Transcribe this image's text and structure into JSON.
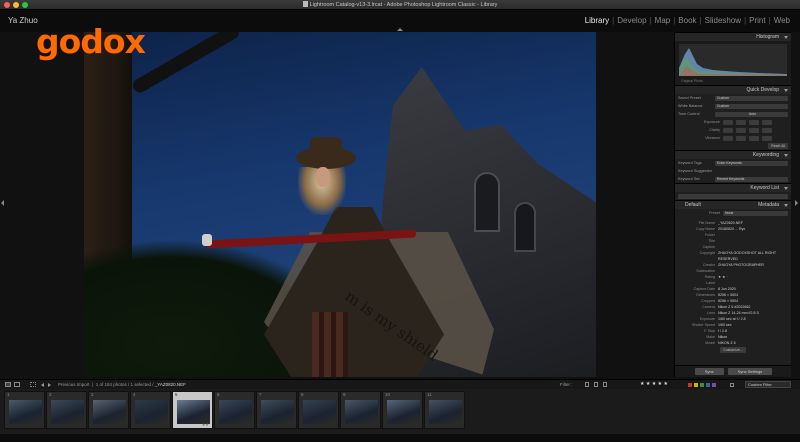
{
  "window": {
    "title": "Lightroom Catalog-v13-3.lrcat - Adobe Photoshop Lightroom Classic - Library"
  },
  "identity_plate": "Ya Zhuo",
  "modules": [
    "Library",
    "Develop",
    "Map",
    "Book",
    "Slideshow",
    "Print",
    "Web"
  ],
  "active_module": "Library",
  "logo_text": "godox",
  "photo": {
    "banner_text": "m is my shield"
  },
  "right_panel": {
    "histogram": {
      "title": "Histogram",
      "info": "Original Photo"
    },
    "quick_develop": {
      "title": "Quick Develop",
      "saved_preset_label": "Saved Preset",
      "saved_preset_value": "Custom",
      "white_balance_label": "White Balance",
      "white_balance_value": "Custom",
      "tone_control_label": "Tone Control",
      "tone_control_value": "Auto",
      "sliders": [
        "Exposure",
        "Clarity",
        "Vibrance"
      ],
      "reset_label": "Reset All"
    },
    "keywording": {
      "title": "Keywording",
      "keyword_tags_label": "Keyword Tags",
      "keyword_tags_value": "Enter Keywords",
      "suggestions_label": "Keyword Suggestions",
      "keyword_set_label": "Keyword Set",
      "keyword_set_value": "Recent Keywords"
    },
    "keyword_list": {
      "title": "Keyword List"
    },
    "metadata": {
      "title": "Metadata",
      "preset_label": "Default",
      "preset2_label": "Preset",
      "preset2_value": "None",
      "fields": [
        {
          "k": "File Name",
          "v": "_YAZ0820.NEF"
        },
        {
          "k": "Copy Name",
          "v": "20180820 ... Ryx"
        },
        {
          "k": "Folder",
          "v": ""
        },
        {
          "k": "Title",
          "v": ""
        },
        {
          "k": "Caption",
          "v": ""
        },
        {
          "k": "Copyright",
          "v": "ZHUOYA GODOXSHOT ALL RIGHT"
        },
        {
          "k": "",
          "v": "RESERVED"
        },
        {
          "k": "Creator",
          "v": "ZHUOYA PHOTOGRAPHER"
        },
        {
          "k": "Sublocation",
          "v": ""
        },
        {
          "k": "Rating",
          "v": "★ ★ ·"
        },
        {
          "k": "Label",
          "v": ""
        },
        {
          "k": "Capture Date",
          "v": "8 Jun 2020"
        },
        {
          "k": "Dimensions",
          "v": "8256 × 5504"
        },
        {
          "k": "Cropped",
          "v": "8256 × 5504"
        },
        {
          "k": "Camera",
          "v": "Nikon Z 6 #2022662"
        },
        {
          "k": "Lens",
          "v": "Nikon Z 14-24 mm f/2.8 S"
        },
        {
          "k": "Exposure",
          "v": "1/60 sec at f / 2.8"
        },
        {
          "k": "Shutter Speed",
          "v": "1/60 sec"
        },
        {
          "k": "F-Stop",
          "v": "f / 2.8"
        },
        {
          "k": "Make",
          "v": "Nikon"
        },
        {
          "k": "Model",
          "v": "NIKON Z 6"
        }
      ],
      "customize_label": "Customize..."
    },
    "sync_label": "Sync",
    "sync_settings_label": "Sync Settings"
  },
  "filmstrip_toolbar": {
    "source_label": "Previous Import",
    "count_text": "1 of 184 photos / 1 selected /",
    "file_name": "_YAZ0820.NEF",
    "filter_label": "Filter :",
    "rating_stars": "★ ★ ★ ★ ★",
    "custom_filter": "Custom Filter"
  },
  "filmstrip": {
    "thumbs": [
      "1",
      "2",
      "3",
      "4",
      "5",
      "6",
      "7",
      "8",
      "9",
      "10",
      "11"
    ],
    "selected_index": 4,
    "selected_badge": "★★"
  },
  "colors": {
    "logo": "#ff6a00",
    "accent_label_red": "#c0392b",
    "accent_label_yellow": "#d4b106",
    "accent_label_green": "#3c8f3c",
    "accent_label_blue": "#3465a4",
    "accent_label_purple": "#7b4f9e"
  }
}
